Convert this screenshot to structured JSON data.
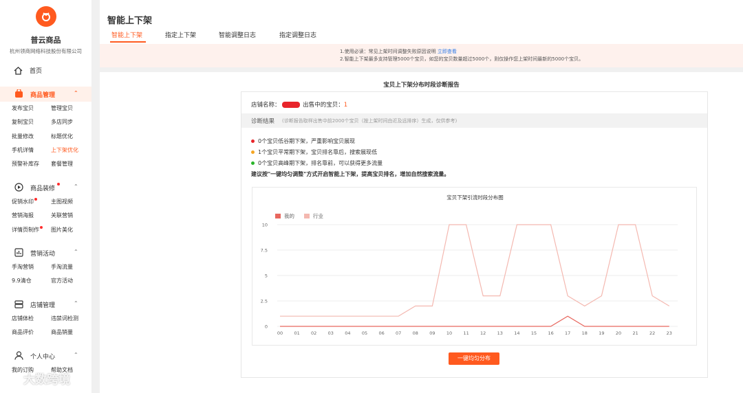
{
  "brand": {
    "name": "普云商品",
    "company": "杭州领商网络科技股份有限公司"
  },
  "nav": {
    "home": "首页",
    "groups": [
      {
        "label": "商品管理",
        "active": true,
        "dot": false,
        "items": [
          "发布宝贝",
          "管理宝贝",
          "复制宝贝",
          "多店同步",
          "批量修改",
          "标题优化",
          "手机详情",
          "上下架优化",
          "预警补库存",
          "套餐管理"
        ],
        "selected": "上下架优化"
      },
      {
        "label": "商品装修",
        "active": false,
        "dot": true,
        "items": [
          "促销水印",
          "主图视频",
          "营销海报",
          "关联营销",
          "详情页制作",
          "图片美化"
        ],
        "dots": [
          "促销水印",
          "详情页制作"
        ]
      },
      {
        "label": "营销活动",
        "active": false,
        "dot": false,
        "items": [
          "手淘营销",
          "手淘流量",
          "9.9清仓",
          "官方活动"
        ]
      },
      {
        "label": "店铺管理",
        "active": false,
        "dot": false,
        "items": [
          "店铺体检",
          "违禁词检测",
          "商品评价",
          "商品销量"
        ]
      },
      {
        "label": "个人中心",
        "active": false,
        "dot": false,
        "items": [
          "我的订购",
          "帮助文档"
        ]
      }
    ]
  },
  "header": {
    "title": "智能上下架",
    "tabs": [
      "智能上下架",
      "指定上下架",
      "智能调整日志",
      "指定调整日志"
    ],
    "active_tab": 0
  },
  "notice": {
    "line1": "1.使用必读：常见上架时间调整失败原因说明",
    "line1_link": "立即查看",
    "line2": "2.智能上下架最多支持管理5000个宝贝，如您的宝贝数量超过5000个，则仅操作您上架时间最新的5000个宝贝。"
  },
  "report": {
    "title": "宝贝上下架分布时段诊断报告",
    "shop_label": "店铺名称：",
    "on_sale_label": "出售中的宝贝：",
    "on_sale_count": "1",
    "diag_title": "诊断结果",
    "diag_sub": "(诊断报告取样出售中前2000个宝贝（按上架时间由近及远排序）生成，仅供参考)",
    "results": [
      {
        "text": "0个宝贝低谷期下架，严重影响宝贝展现",
        "color": "#e8252b"
      },
      {
        "text": "1个宝贝平常期下架，宝贝排名靠后，搜索展现低",
        "color": "#f5a623"
      },
      {
        "text": "0个宝贝高峰期下架，排名靠前，可以获得更多流量",
        "color": "#2bb52b"
      }
    ],
    "advice": "建议按\"一键均匀调整\"方式开启智能上下架，提高宝贝排名，增加自然搜索流量。",
    "button": "一键均匀分布"
  },
  "chart_data": {
    "type": "line",
    "title": "宝贝下架引流时段分布图",
    "categories": [
      "00",
      "01",
      "02",
      "03",
      "04",
      "05",
      "06",
      "07",
      "08",
      "09",
      "10",
      "11",
      "12",
      "13",
      "14",
      "15",
      "16",
      "17",
      "18",
      "19",
      "20",
      "21",
      "22",
      "23"
    ],
    "ylim": [
      0,
      10
    ],
    "yticks": [
      "0",
      "2.5",
      "5",
      "7.5",
      "10"
    ],
    "series": [
      {
        "name": "我的",
        "color": "#e8675e",
        "values": [
          0,
          0,
          0,
          0,
          0,
          0,
          0,
          0,
          0,
          0,
          0,
          0,
          0,
          0,
          0,
          0,
          0,
          1,
          0,
          0,
          0,
          0,
          0,
          0
        ]
      },
      {
        "name": "行业",
        "color": "#f4b8b0",
        "values": [
          1,
          1,
          1,
          1,
          1,
          1,
          1,
          1,
          2,
          2,
          10,
          10,
          3,
          3,
          10,
          10,
          10,
          3,
          2,
          3,
          10,
          10,
          3,
          2
        ]
      }
    ],
    "legend": "top-left",
    "grid": true
  },
  "watermark": "大数跨境"
}
